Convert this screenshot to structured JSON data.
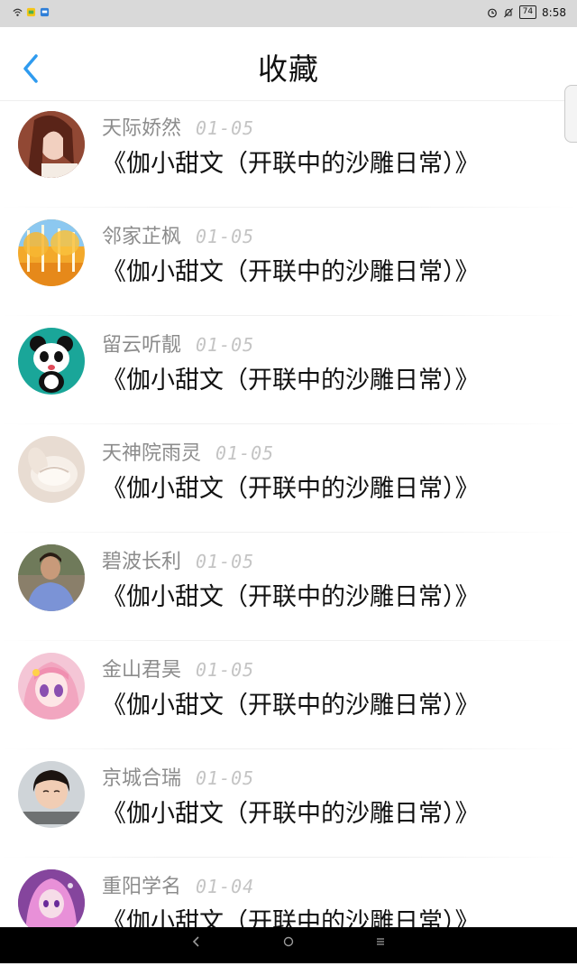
{
  "status_bar": {
    "time": "8:58",
    "battery": "74"
  },
  "header": {
    "title": "收藏"
  },
  "favorites": [
    {
      "author": "天际娇然",
      "date": "01-05",
      "title": "《伽小甜文（开联中的沙雕日常）》",
      "avatar": "girl-photo"
    },
    {
      "author": "邻家芷枫",
      "date": "01-05",
      "title": "《伽小甜文（开联中的沙雕日常）》",
      "avatar": "autumn-trees"
    },
    {
      "author": "留云听靓",
      "date": "01-05",
      "title": "《伽小甜文（开联中的沙雕日常）》",
      "avatar": "panda-cartoon"
    },
    {
      "author": "天神院雨灵",
      "date": "01-05",
      "title": "《伽小甜文（开联中的沙雕日常）》",
      "avatar": "dumpling"
    },
    {
      "author": "碧波长利",
      "date": "01-05",
      "title": "《伽小甜文（开联中的沙雕日常）》",
      "avatar": "man-photo"
    },
    {
      "author": "金山君昊",
      "date": "01-05",
      "title": "《伽小甜文（开联中的沙雕日常）》",
      "avatar": "anime-girl-pink"
    },
    {
      "author": "京城合瑞",
      "date": "01-05",
      "title": "《伽小甜文（开联中的沙雕日常）》",
      "avatar": "child-photo"
    },
    {
      "author": "重阳学名",
      "date": "01-04",
      "title": "《伽小甜文（开联中的沙雕日常）》",
      "avatar": "fantasy-heroine"
    }
  ],
  "colors": {
    "accent": "#2f9bef",
    "author_text": "#8c8c8c",
    "date_text": "#c4c4c4",
    "title_text": "#111111"
  }
}
